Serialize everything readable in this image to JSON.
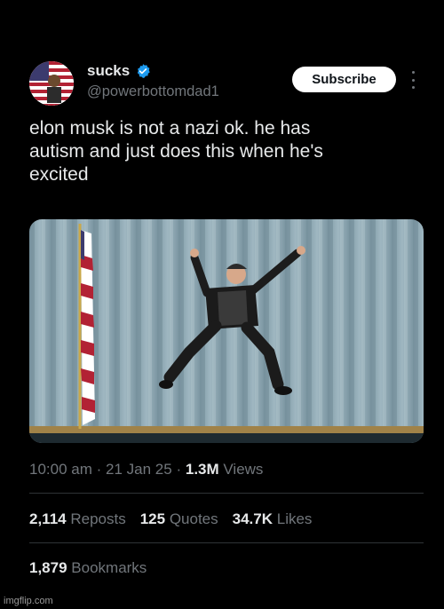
{
  "profile": {
    "name": "sucks",
    "handle": "@powerbottomdad1",
    "verified": true,
    "verified_color": "#1d9bf0"
  },
  "actions": {
    "subscribe_label": "Subscribe",
    "more_icon": "more-options-icon"
  },
  "tweet": {
    "line1": "elon musk is not a nazi ok. he has",
    "line2": "autism and just does this when he's",
    "line3": "excited"
  },
  "meta": {
    "time": "10:00 am",
    "sep1": "·",
    "date": "21 Jan 25",
    "sep2": "·",
    "views_count": "1.3M",
    "views_label": "Views"
  },
  "stats": {
    "reposts_count": "2,114",
    "reposts_label": "Reposts",
    "quotes_count": "125",
    "quotes_label": "Quotes",
    "likes_count": "34.7K",
    "likes_label": "Likes",
    "bookmarks_count": "1,879",
    "bookmarks_label": "Bookmarks"
  },
  "watermark": "imgflip.com"
}
